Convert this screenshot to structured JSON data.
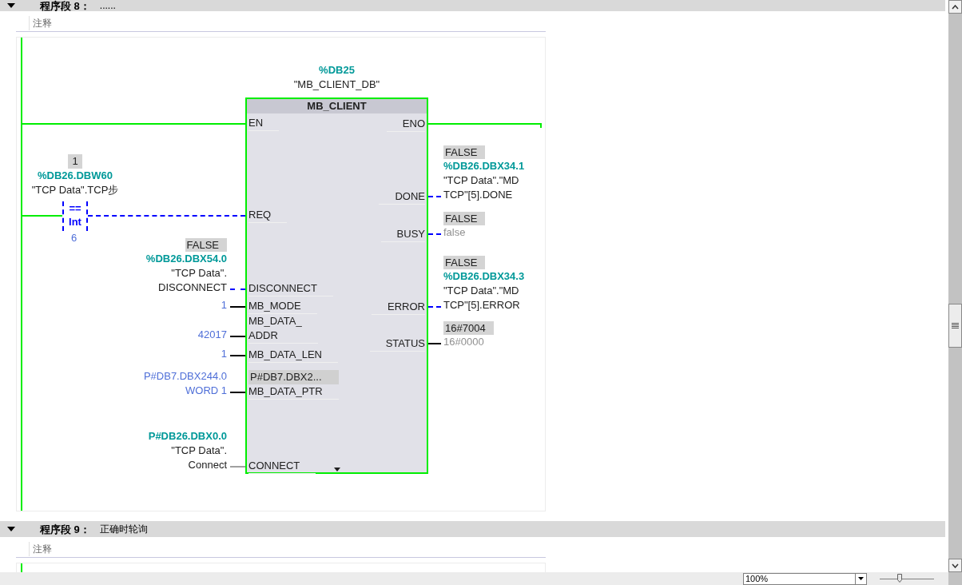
{
  "networks": [
    {
      "label": "程序段 8：",
      "title": "......",
      "comment": "注释",
      "expanded": true
    },
    {
      "label": "程序段 9：",
      "title": "正确时轮询",
      "comment": "注释",
      "expanded": true
    }
  ],
  "compare": {
    "online": "1",
    "address": "%DB26.DBW60",
    "symbol": "\"TCP Data\".TCP步",
    "operator": "==",
    "type": "Int",
    "value": "6"
  },
  "block": {
    "instance": "%DB25",
    "instance_name": "\"MB_CLIENT_DB\"",
    "name": "MB_CLIENT",
    "inputs": [
      {
        "pin": [
          "EN"
        ],
        "kind": "power"
      },
      {
        "pin": [
          "REQ"
        ],
        "kind": "bool"
      },
      {
        "pin": [
          "DISCONNECT"
        ],
        "kind": "bool",
        "online": "FALSE",
        "address": "%DB26.DBX54.0",
        "symbol": [
          "\"TCP Data\".",
          "DISCONNECT"
        ]
      },
      {
        "pin": [
          "MB_MODE"
        ],
        "kind": "value",
        "value": [
          "1"
        ]
      },
      {
        "pin": [
          "MB_DATA_",
          "ADDR"
        ],
        "kind": "value",
        "value": [
          "42017"
        ]
      },
      {
        "pin": [
          "MB_DATA_LEN"
        ],
        "kind": "value",
        "value": [
          "1"
        ]
      },
      {
        "pin": [
          "MB_DATA_PTR"
        ],
        "kind": "value",
        "value": [
          "P#DB7.DBX244.0",
          "WORD 1"
        ],
        "inner_online": "P#DB7.DBX2..."
      },
      {
        "pin": [
          "CONNECT"
        ],
        "kind": "pointer",
        "address": "P#DB26.DBX0.0",
        "symbol": [
          "\"TCP Data\".",
          "Connect"
        ]
      }
    ],
    "outputs": [
      {
        "pin": "ENO",
        "kind": "power"
      },
      {
        "pin": "DONE",
        "kind": "bool",
        "online": "FALSE",
        "address": "%DB26.DBX34.1",
        "symbol": [
          "\"TCP Data\".\"MD",
          "TCP\"[5].DONE"
        ]
      },
      {
        "pin": "BUSY",
        "kind": "bool",
        "online": "FALSE",
        "default": "false"
      },
      {
        "pin": "ERROR",
        "kind": "bool",
        "online": "FALSE",
        "address": "%DB26.DBX34.3",
        "symbol": [
          "\"TCP Data\".\"MD",
          "TCP\"[5].ERROR"
        ]
      },
      {
        "pin": "STATUS",
        "kind": "value",
        "online": "16#7004",
        "default": "16#0000"
      }
    ]
  },
  "zoom": "100%",
  "zoom_slider": {
    "level": 0.35
  }
}
